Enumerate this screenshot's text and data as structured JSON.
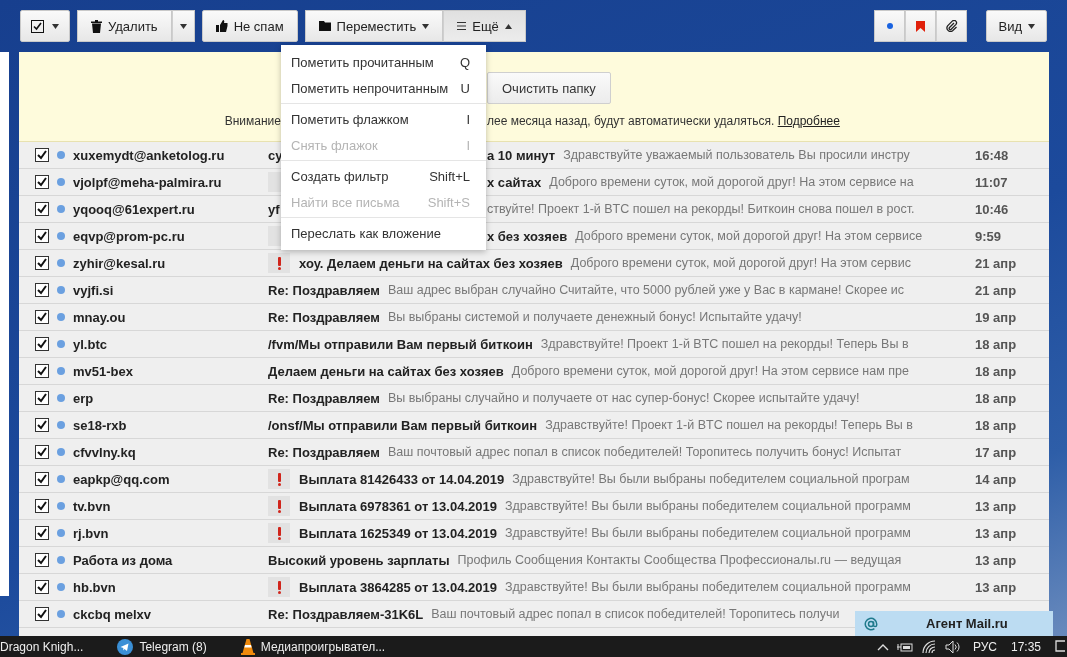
{
  "toolbar": {
    "delete_label": "Удалить",
    "not_spam_label": "Не спам",
    "move_label": "Переместить",
    "more": {
      "label": "Ещё",
      "selected": true
    },
    "view_label": "Вид"
  },
  "menu": {
    "groups": [
      [
        {
          "label": "Пометить прочитанным",
          "shortcut": "Q",
          "disabled": false
        },
        {
          "label": "Пометить непрочитанным",
          "shortcut": "U",
          "disabled": false
        }
      ],
      [
        {
          "label": "Пометить флажком",
          "shortcut": "I",
          "disabled": false
        },
        {
          "label": "Снять флажок",
          "shortcut": "I",
          "disabled": true
        }
      ],
      [
        {
          "label": "Создать фильтр",
          "shortcut": "Shift+L",
          "disabled": false
        },
        {
          "label": "Найти все письма",
          "shortcut": "Shift+S",
          "disabled": true
        }
      ],
      [
        {
          "label": "Переслать как вложение",
          "disabled": false
        }
      ]
    ]
  },
  "notice": {
    "button": "Очистить папку",
    "text_head": "Внимание",
    "text_tail": "лее месяца назад, будут автоматически удаляться.",
    "link": "Подробнее"
  },
  "emails": [
    {
      "kind": "covered",
      "checked": true,
      "unread": true,
      "sender": "xuxemydt@anketolog.ru",
      "important": false,
      "subject_head": "су",
      "subject": "а 10 минут",
      "snippet": "Здравствуйте уважаемый пользователь Вы просили инстру",
      "date": "16:48"
    },
    {
      "kind": "covered",
      "checked": true,
      "unread": true,
      "sender": "vjolpf@meha-palmira.ru",
      "important": true,
      "subject": "х сайтах",
      "snippet": "Доброго времени суток, мой дорогой друг! На этом сервисе на",
      "date": "11:07"
    },
    {
      "kind": "covered",
      "checked": true,
      "unread": true,
      "sender": "yqooq@61expert.ru",
      "important": false,
      "subject_head": "yf",
      "snippet": "ствуйте! Проект 1-й BTC пошел на рекорды! Биткоин снова пошел в рост.",
      "date": "10:46"
    },
    {
      "kind": "covered",
      "checked": true,
      "unread": true,
      "sender": "eqvp@prom-pc.ru",
      "important": true,
      "subject": "х без хозяев",
      "snippet": "Доброго времени суток, мой дорогой друг! На этом сервисе",
      "date": "9:59"
    },
    {
      "kind": "plain",
      "checked": true,
      "unread": true,
      "sender": "zyhir@kesal.ru",
      "important": true,
      "subject": "хоу. Делаем деньги на сайтах без хозяев",
      "snippet": "Доброго времени суток, мой дорогой друг! На этом сервис",
      "date": "21 апр"
    },
    {
      "kind": "plain",
      "checked": true,
      "unread": true,
      "sender": "vyjfi.si",
      "important": false,
      "subject": "Re: Поздравляем",
      "snippet": "Ваш адрес выбран случайно Считайте, что 5000 рублей уже у Вас в кармане! Скорее ис",
      "date": "21 апр"
    },
    {
      "kind": "plain",
      "checked": true,
      "unread": true,
      "sender": "mnay.ou",
      "important": false,
      "subject": "Re: Поздравляем",
      "snippet": "Вы выбраны системой и получаете денежный бонус! Испытайте удачу!",
      "date": "19 апр"
    },
    {
      "kind": "plain",
      "checked": true,
      "unread": true,
      "sender": "yl.btc",
      "important": false,
      "subject": "/fvm/Мы отправили Вам первый биткоин",
      "snippet": "Здравствуйте! Проект 1-й BTC пошел на рекорды! Теперь Вы в",
      "date": "18 апр"
    },
    {
      "kind": "plain",
      "checked": true,
      "unread": true,
      "sender": "mv51-bex",
      "important": false,
      "subject": "Делаем деньги на сайтах без хозяев",
      "snippet": "Доброго времени суток, мой дорогой друг! На этом сервисе нам пре",
      "date": "18 апр"
    },
    {
      "kind": "plain",
      "checked": true,
      "unread": true,
      "sender": "erp",
      "important": false,
      "subject": "Re: Поздравляем",
      "snippet": "Вы выбраны случайно и получаете от нас супер-бонус! Скорее испытайте удачу!",
      "date": "18 апр"
    },
    {
      "kind": "plain",
      "checked": true,
      "unread": true,
      "sender": "se18-rxb",
      "important": false,
      "subject": "/onsf/Мы отправили Вам первый биткоин",
      "snippet": "Здравствуйте! Проект 1-й BTC пошел на рекорды! Теперь Вы в",
      "date": "18 апр"
    },
    {
      "kind": "plain",
      "checked": true,
      "unread": true,
      "sender": "cfvvlny.kq",
      "important": false,
      "subject": "Re: Поздравляем",
      "snippet": "Ваш почтовый адрес попал в список победителей! Торопитесь получить бонус! Испытат",
      "date": "17 апр"
    },
    {
      "kind": "plain",
      "checked": true,
      "unread": true,
      "sender": "eapkp@qq.com",
      "important": true,
      "subject": "Выплата 81426433 от 14.04.2019",
      "snippet": "Здравствуйте! Вы были выбраны победителем социальной програм",
      "date": "14 апр"
    },
    {
      "kind": "plain",
      "checked": true,
      "unread": true,
      "sender": "tv.bvn",
      "important": true,
      "subject": "Выплата 6978361 от 13.04.2019",
      "snippet": "Здравствуйте! Вы были выбраны победителем социальной программ",
      "date": "13 апр"
    },
    {
      "kind": "plain",
      "checked": true,
      "unread": true,
      "sender": "rj.bvn",
      "important": true,
      "subject": "Выплата 1625349 от 13.04.2019",
      "snippet": "Здравствуйте! Вы были выбраны победителем социальной программ",
      "date": "13 апр"
    },
    {
      "kind": "plain",
      "checked": true,
      "unread": true,
      "sender": "Работа из дома",
      "important": false,
      "subject": "Высокий уровень зарплаты",
      "snippet": "Профиль Сообщения Контакты Сообщества Профессионалы.ru — ведущая",
      "date": "13 апр"
    },
    {
      "kind": "plain",
      "checked": true,
      "unread": true,
      "sender": "hb.bvn",
      "important": true,
      "subject": "Выплата 3864285 от 13.04.2019",
      "snippet": "Здравствуйте! Вы были выбраны победителем социальной программ",
      "date": "13 апр"
    },
    {
      "kind": "plain",
      "checked": true,
      "unread": true,
      "sender": "ckcbq melxv",
      "important": false,
      "subject": "Re: Поздравляем-31K6L",
      "snippet": "Ваш почтовый адрес попал в список победителей! Торопитесь получи"
    }
  ],
  "agent_popup": {
    "title": "Агент Mail.ru"
  },
  "taskbar": {
    "apps": [
      {
        "kind": "plain",
        "label": "Dragon Knigh..."
      },
      {
        "kind": "telegram",
        "label": "Telegram (8)"
      },
      {
        "kind": "cone",
        "label": "Медиапроигрывател..."
      }
    ],
    "language": "РУС",
    "time": "17:35"
  }
}
